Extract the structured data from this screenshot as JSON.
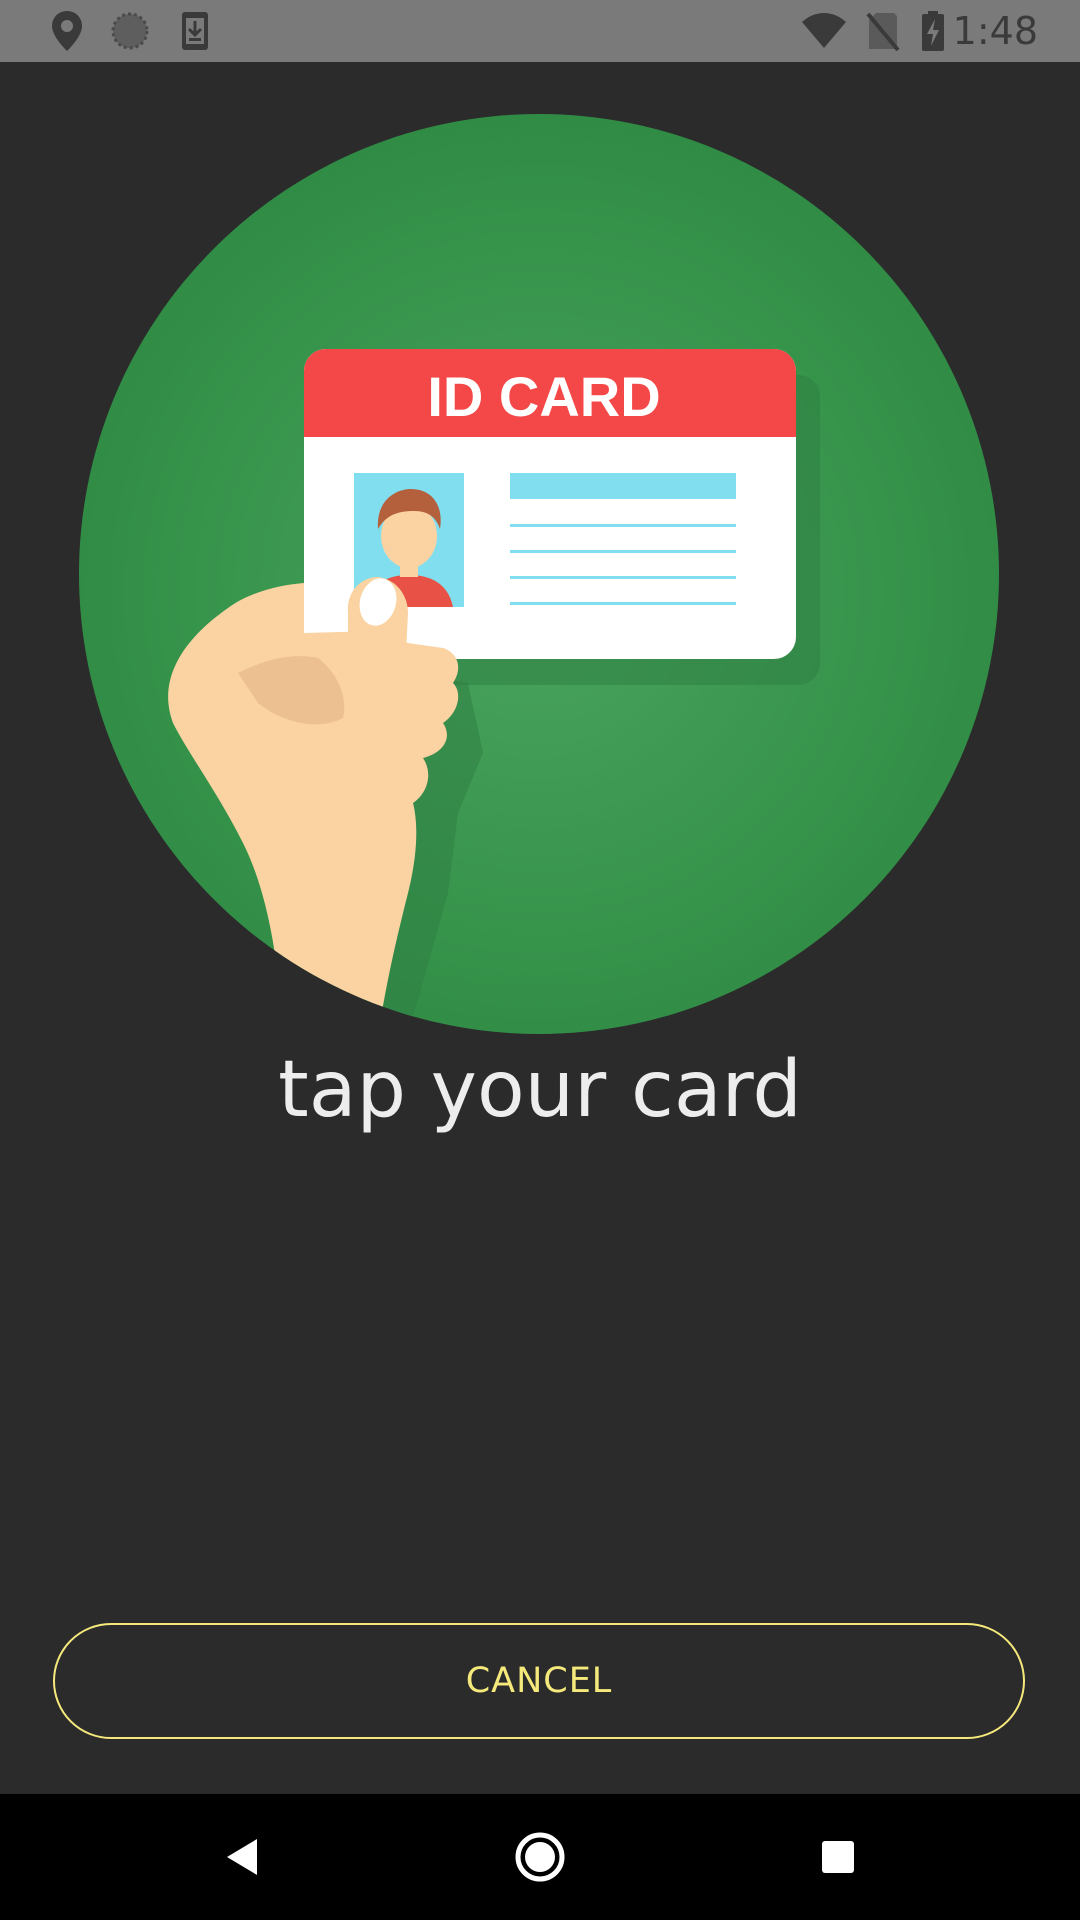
{
  "status_bar": {
    "time": "1:48",
    "left_icons": [
      "location-pin-icon",
      "sync-circle-icon",
      "download-icon"
    ],
    "right_icons": [
      "wifi-icon",
      "no-sim-icon",
      "battery-charging-icon"
    ]
  },
  "illustration": {
    "card_title": "ID CARD",
    "colors": {
      "circle": "#3a9a4e",
      "card_header": "#f44848",
      "photo_bg": "#80deef",
      "lines": "#80deef",
      "skin": "#fbd3a3"
    }
  },
  "prompt": {
    "text": "tap your card"
  },
  "actions": {
    "cancel_label": "CANCEL"
  },
  "colors": {
    "background": "#2b2b2b",
    "accent": "#f5e97c",
    "status_bar": "#7a7a7a"
  },
  "navigation": {
    "buttons": [
      "back-icon",
      "home-icon",
      "recents-icon"
    ]
  }
}
